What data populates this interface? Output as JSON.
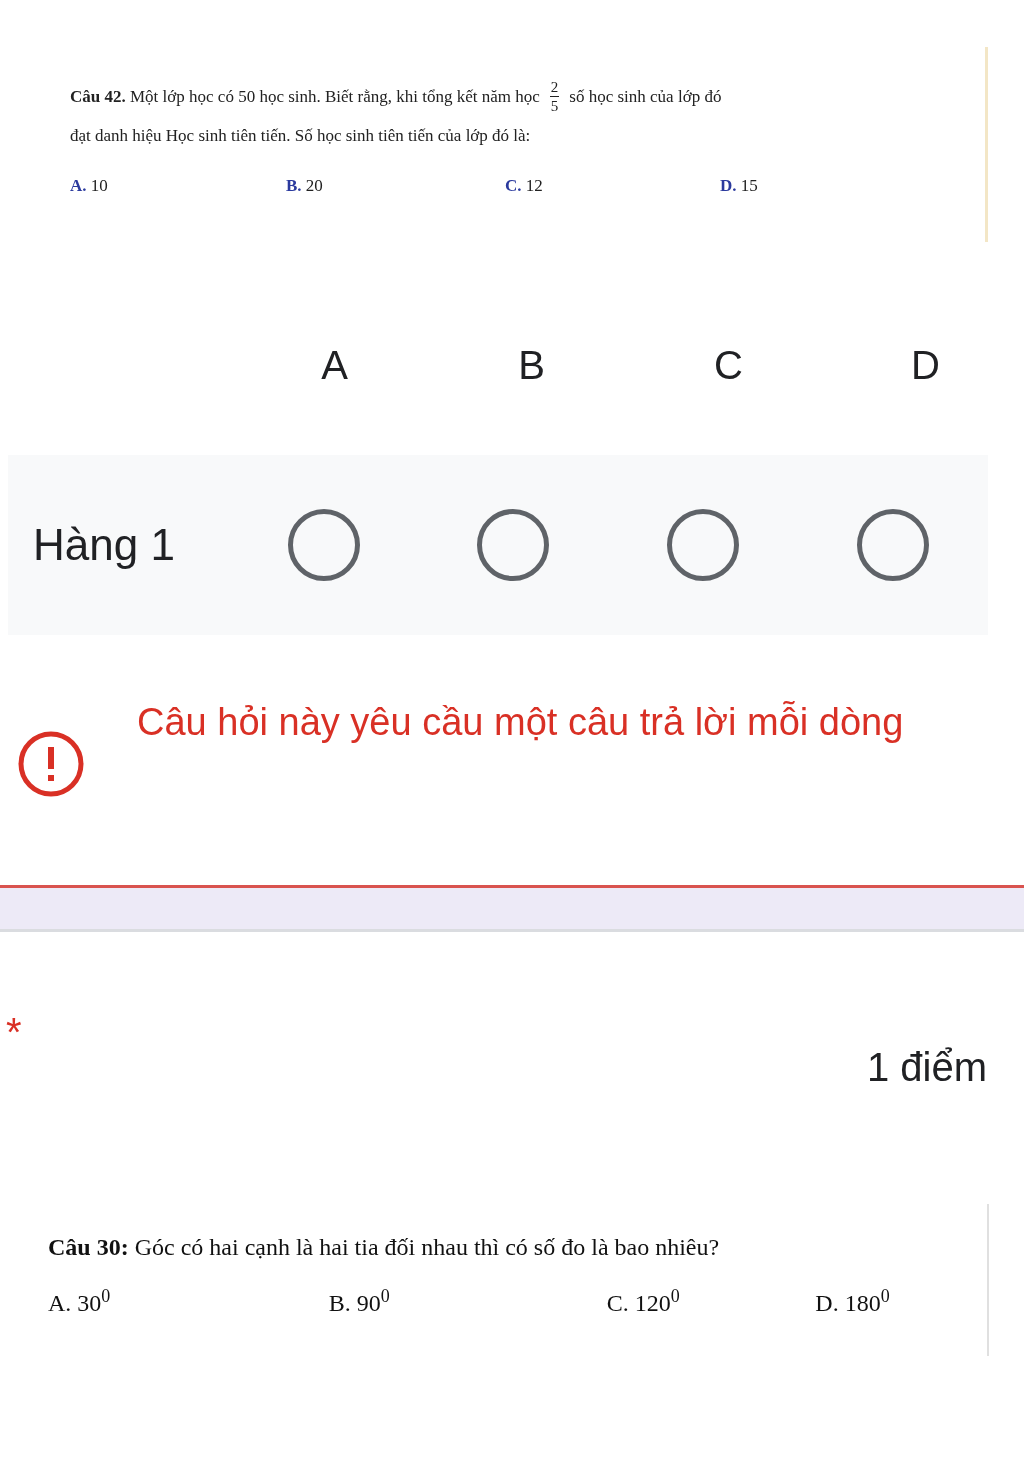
{
  "question_image_1": {
    "label": "Câu 42.",
    "text_before": "Một lớp học có 50 học sinh. Biết rằng, khi tổng kết năm học",
    "fraction": {
      "numerator": "2",
      "denominator": "5"
    },
    "text_after": "số học sinh của lớp đó",
    "line_2": "đạt danh hiệu Học sinh tiên tiến. Số học sinh tiên tiến của lớp đó là:",
    "options": [
      {
        "letter": "A.",
        "value": "10"
      },
      {
        "letter": "B.",
        "value": "20"
      },
      {
        "letter": "C.",
        "value": "12"
      },
      {
        "letter": "D.",
        "value": "15"
      }
    ]
  },
  "grid": {
    "columns": [
      "A",
      "B",
      "C",
      "D"
    ],
    "rows": [
      {
        "label": "Hàng 1",
        "choices": [
          {
            "selected": false
          },
          {
            "selected": false
          },
          {
            "selected": false
          },
          {
            "selected": false
          }
        ]
      }
    ],
    "error": "Câu hỏi này yêu cầu một câu trả lời mỗi dòng"
  },
  "next_question": {
    "required_mark": "*",
    "points": "1 điểm",
    "image": {
      "label": "Câu 30:",
      "text": "Góc có hai cạnh là hai tia đối nhau thì có số đo là bao nhiêu?",
      "options": [
        "A. 30$^{0}$",
        "B. 90$^{0}$",
        "C. 120$^{0}$",
        "D. 180$^{0}$"
      ]
    }
  }
}
